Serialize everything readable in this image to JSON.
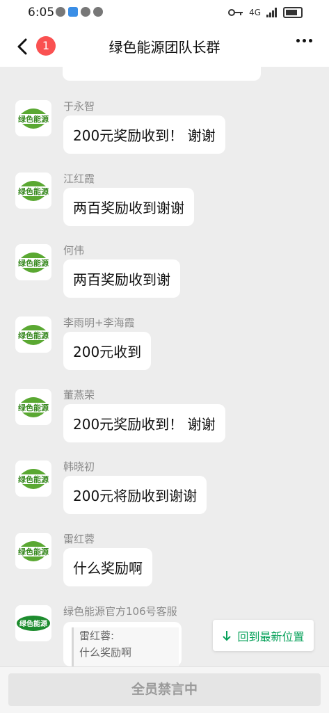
{
  "status_bar": {
    "time": "6:05",
    "network": "4G"
  },
  "header": {
    "badge_count": "1",
    "title": "绿色能源团队长群"
  },
  "messages": [
    {
      "sender": "于永智",
      "text": "200元奖励收到！ 谢谢"
    },
    {
      "sender": "江红霞",
      "text": "两百奖励收到谢谢"
    },
    {
      "sender": "何伟",
      "text": "两百奖励收到谢"
    },
    {
      "sender": "李雨明+李海霞",
      "text": "200元收到"
    },
    {
      "sender": "董燕荣",
      "text": "200元奖励收到！ 谢谢"
    },
    {
      "sender": "韩晓初",
      "text": "200元将励收到谢谢"
    },
    {
      "sender": "雷红蓉",
      "text": "什么奖励啊"
    }
  ],
  "last_message": {
    "sender": "绿色能源官方106号客服",
    "quote_sender": "雷红蓉:",
    "quote_text": "什么奖励啊"
  },
  "avatar_logo_text": "绿色能源",
  "jump_button": {
    "label": "回到最新位置"
  },
  "bottom_bar": {
    "muted_label": "全员禁言中"
  },
  "colors": {
    "accent": "#07a15a",
    "badge": "#fa5151",
    "background": "#ededed"
  }
}
